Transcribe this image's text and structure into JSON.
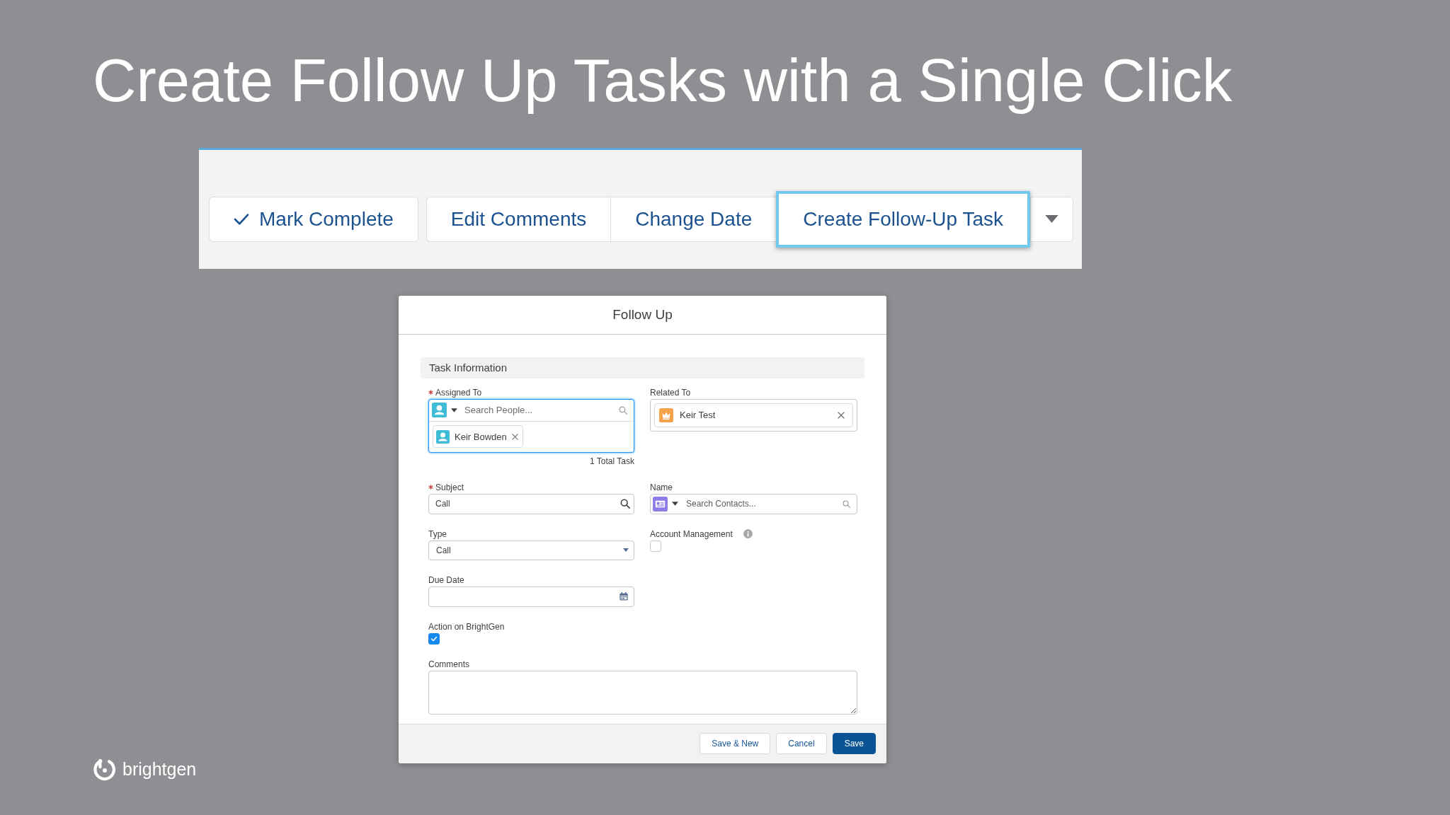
{
  "slide": {
    "title": "Create Follow Up Tasks with a Single Click"
  },
  "action_bar": {
    "buttons": [
      {
        "label": "Mark Complete",
        "kind": "standalone",
        "selected": false
      },
      {
        "label": "Edit Comments",
        "kind": "grouped",
        "selected": false
      },
      {
        "label": "Change Date",
        "kind": "grouped",
        "selected": false
      },
      {
        "label": "Create Follow-Up Task",
        "kind": "grouped",
        "selected": true
      }
    ]
  },
  "dialog": {
    "title": "Follow Up",
    "section": "Task Information",
    "rows": [
      {
        "fields": [
          {
            "kind": "people-lookup",
            "label": "Assigned To",
            "required": true,
            "focused": true,
            "placeholder": "Search People...",
            "pills": [
              "Keir Bowden"
            ],
            "note": "1 Total Task"
          },
          {
            "kind": "record-lookup",
            "label": "Related To",
            "focused": false,
            "value": "Keir Test"
          }
        ]
      },
      {
        "fields": [
          {
            "kind": "search-text",
            "label": "Subject",
            "required": true,
            "focused": false,
            "value": "Call"
          },
          {
            "kind": "contact-lookup",
            "label": "Name",
            "focused": false,
            "placeholder": "Search Contacts..."
          }
        ]
      },
      {
        "fields": [
          {
            "kind": "select",
            "label": "Type",
            "focused": false,
            "value": "Call"
          },
          {
            "kind": "checkbox",
            "label": "Account Management",
            "info": true,
            "checked": false
          }
        ]
      },
      {
        "fields": [
          {
            "kind": "date",
            "label": "Due Date",
            "focused": false
          }
        ]
      },
      {
        "fields": [
          {
            "kind": "checkbox",
            "label": "Action on BrightGen",
            "checked": true
          }
        ]
      },
      {
        "fields": [
          {
            "kind": "textarea",
            "label": "Comments",
            "focused": false
          }
        ]
      }
    ],
    "buttons": [
      {
        "label": "Save & New",
        "kind": "neutral"
      },
      {
        "label": "Cancel",
        "kind": "neutral"
      },
      {
        "label": "Save",
        "kind": "brand"
      }
    ]
  },
  "logo": {
    "text": "brightgen"
  }
}
